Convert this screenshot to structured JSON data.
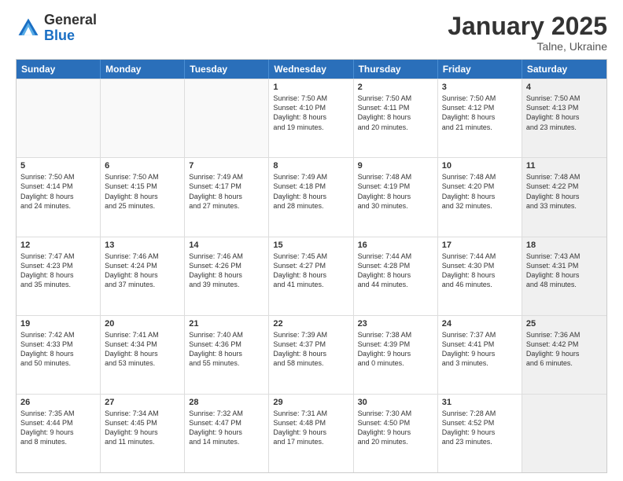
{
  "logo": {
    "general": "General",
    "blue": "Blue"
  },
  "title": "January 2025",
  "subtitle": "Talne, Ukraine",
  "header_days": [
    "Sunday",
    "Monday",
    "Tuesday",
    "Wednesday",
    "Thursday",
    "Friday",
    "Saturday"
  ],
  "rows": [
    [
      {
        "day": "",
        "info": "",
        "empty": true
      },
      {
        "day": "",
        "info": "",
        "empty": true
      },
      {
        "day": "",
        "info": "",
        "empty": true
      },
      {
        "day": "1",
        "info": "Sunrise: 7:50 AM\nSunset: 4:10 PM\nDaylight: 8 hours\nand 19 minutes."
      },
      {
        "day": "2",
        "info": "Sunrise: 7:50 AM\nSunset: 4:11 PM\nDaylight: 8 hours\nand 20 minutes."
      },
      {
        "day": "3",
        "info": "Sunrise: 7:50 AM\nSunset: 4:12 PM\nDaylight: 8 hours\nand 21 minutes."
      },
      {
        "day": "4",
        "info": "Sunrise: 7:50 AM\nSunset: 4:13 PM\nDaylight: 8 hours\nand 23 minutes.",
        "shaded": true
      }
    ],
    [
      {
        "day": "5",
        "info": "Sunrise: 7:50 AM\nSunset: 4:14 PM\nDaylight: 8 hours\nand 24 minutes."
      },
      {
        "day": "6",
        "info": "Sunrise: 7:50 AM\nSunset: 4:15 PM\nDaylight: 8 hours\nand 25 minutes."
      },
      {
        "day": "7",
        "info": "Sunrise: 7:49 AM\nSunset: 4:17 PM\nDaylight: 8 hours\nand 27 minutes."
      },
      {
        "day": "8",
        "info": "Sunrise: 7:49 AM\nSunset: 4:18 PM\nDaylight: 8 hours\nand 28 minutes."
      },
      {
        "day": "9",
        "info": "Sunrise: 7:48 AM\nSunset: 4:19 PM\nDaylight: 8 hours\nand 30 minutes."
      },
      {
        "day": "10",
        "info": "Sunrise: 7:48 AM\nSunset: 4:20 PM\nDaylight: 8 hours\nand 32 minutes."
      },
      {
        "day": "11",
        "info": "Sunrise: 7:48 AM\nSunset: 4:22 PM\nDaylight: 8 hours\nand 33 minutes.",
        "shaded": true
      }
    ],
    [
      {
        "day": "12",
        "info": "Sunrise: 7:47 AM\nSunset: 4:23 PM\nDaylight: 8 hours\nand 35 minutes."
      },
      {
        "day": "13",
        "info": "Sunrise: 7:46 AM\nSunset: 4:24 PM\nDaylight: 8 hours\nand 37 minutes."
      },
      {
        "day": "14",
        "info": "Sunrise: 7:46 AM\nSunset: 4:26 PM\nDaylight: 8 hours\nand 39 minutes."
      },
      {
        "day": "15",
        "info": "Sunrise: 7:45 AM\nSunset: 4:27 PM\nDaylight: 8 hours\nand 41 minutes."
      },
      {
        "day": "16",
        "info": "Sunrise: 7:44 AM\nSunset: 4:28 PM\nDaylight: 8 hours\nand 44 minutes."
      },
      {
        "day": "17",
        "info": "Sunrise: 7:44 AM\nSunset: 4:30 PM\nDaylight: 8 hours\nand 46 minutes."
      },
      {
        "day": "18",
        "info": "Sunrise: 7:43 AM\nSunset: 4:31 PM\nDaylight: 8 hours\nand 48 minutes.",
        "shaded": true
      }
    ],
    [
      {
        "day": "19",
        "info": "Sunrise: 7:42 AM\nSunset: 4:33 PM\nDaylight: 8 hours\nand 50 minutes."
      },
      {
        "day": "20",
        "info": "Sunrise: 7:41 AM\nSunset: 4:34 PM\nDaylight: 8 hours\nand 53 minutes."
      },
      {
        "day": "21",
        "info": "Sunrise: 7:40 AM\nSunset: 4:36 PM\nDaylight: 8 hours\nand 55 minutes."
      },
      {
        "day": "22",
        "info": "Sunrise: 7:39 AM\nSunset: 4:37 PM\nDaylight: 8 hours\nand 58 minutes."
      },
      {
        "day": "23",
        "info": "Sunrise: 7:38 AM\nSunset: 4:39 PM\nDaylight: 9 hours\nand 0 minutes."
      },
      {
        "day": "24",
        "info": "Sunrise: 7:37 AM\nSunset: 4:41 PM\nDaylight: 9 hours\nand 3 minutes."
      },
      {
        "day": "25",
        "info": "Sunrise: 7:36 AM\nSunset: 4:42 PM\nDaylight: 9 hours\nand 6 minutes.",
        "shaded": true
      }
    ],
    [
      {
        "day": "26",
        "info": "Sunrise: 7:35 AM\nSunset: 4:44 PM\nDaylight: 9 hours\nand 8 minutes."
      },
      {
        "day": "27",
        "info": "Sunrise: 7:34 AM\nSunset: 4:45 PM\nDaylight: 9 hours\nand 11 minutes."
      },
      {
        "day": "28",
        "info": "Sunrise: 7:32 AM\nSunset: 4:47 PM\nDaylight: 9 hours\nand 14 minutes."
      },
      {
        "day": "29",
        "info": "Sunrise: 7:31 AM\nSunset: 4:48 PM\nDaylight: 9 hours\nand 17 minutes."
      },
      {
        "day": "30",
        "info": "Sunrise: 7:30 AM\nSunset: 4:50 PM\nDaylight: 9 hours\nand 20 minutes."
      },
      {
        "day": "31",
        "info": "Sunrise: 7:28 AM\nSunset: 4:52 PM\nDaylight: 9 hours\nand 23 minutes."
      },
      {
        "day": "",
        "info": "",
        "empty": true,
        "shaded": true
      }
    ]
  ]
}
